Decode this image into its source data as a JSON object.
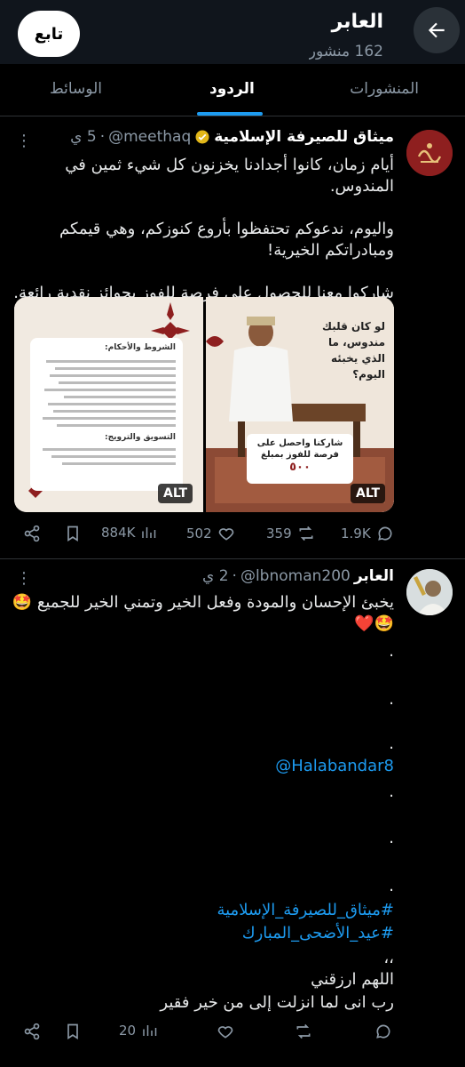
{
  "header": {
    "name": "العابر",
    "subtitle": "162 منشور",
    "follow_label": "تابع"
  },
  "tabs": [
    {
      "label": "المنشورات",
      "active": false
    },
    {
      "label": "الردود",
      "active": true
    },
    {
      "label": "الوسائط",
      "active": false
    }
  ],
  "post1": {
    "name": "ميثاق للصيرفة الإسلامية",
    "verified": true,
    "handle": "@meethaq",
    "time": "5 ي",
    "text": "أيام زمان، كانوا أجدادنا يخزنون كل شيء ثمين في المندوس.\n\nواليوم، ندعوكم تحتفظوا بأروع كنوزكم، وهي قيمكم ومبادراتكم الخيرية!\n\nشاركوا معنا للحصول على فرصة للفوز بجوائز نقدية رائعة.",
    "image_right": {
      "alt": "ALT",
      "headline": "لو كان قلبك مندوس، ما الذي يخبئه اليوم؟",
      "card_text": "شاركنا واحصل على فرصة للفوز بمبلغ",
      "amount": "٥٠٠"
    },
    "image_left": {
      "alt": "ALT",
      "title": "الشروط والأحكام:",
      "section2": "التسويق والترويج:"
    },
    "stats": {
      "replies": "1.9K",
      "reposts": "359",
      "likes": "502",
      "views": "884K"
    }
  },
  "post2": {
    "name": "العابر",
    "handle": "@lbnoman200",
    "time": "2 ي",
    "line1": "يخبئ الإحسان والمودة وفعل الخير وتمني الخير للجميع 🤩",
    "line2": "🤩❤️",
    "dot": ".",
    "mention": "@Halabandar8",
    "hashtag1": "#ميثاق_للصيرفة_الإسلامية",
    "hashtag2": "#عيد_الأضحى_المبارك",
    "quote_mark": "،،",
    "prayer1": "اللهم ارزقني",
    "prayer2": "رب انى لما انزلت إلى من خير فقير",
    "stats": {
      "views": "20"
    }
  }
}
